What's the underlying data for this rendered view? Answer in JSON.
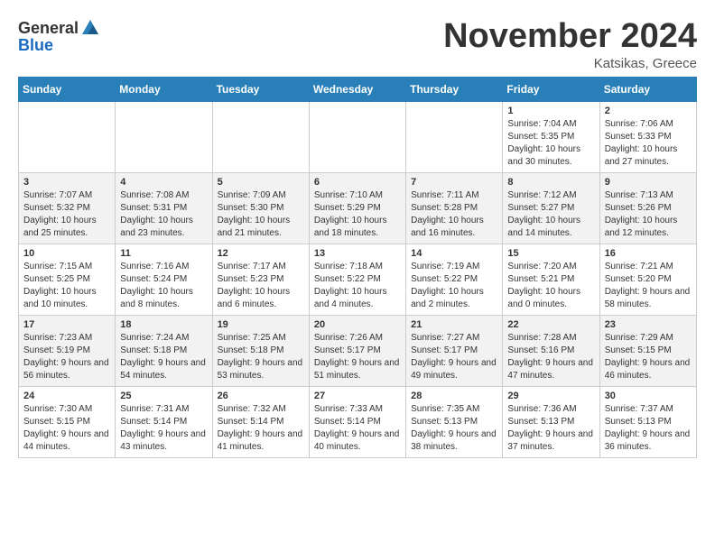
{
  "header": {
    "logo_general": "General",
    "logo_blue": "Blue",
    "month_title": "November 2024",
    "location": "Katsikas, Greece"
  },
  "days_of_week": [
    "Sunday",
    "Monday",
    "Tuesday",
    "Wednesday",
    "Thursday",
    "Friday",
    "Saturday"
  ],
  "weeks": [
    [
      {
        "day": "",
        "info": ""
      },
      {
        "day": "",
        "info": ""
      },
      {
        "day": "",
        "info": ""
      },
      {
        "day": "",
        "info": ""
      },
      {
        "day": "",
        "info": ""
      },
      {
        "day": "1",
        "info": "Sunrise: 7:04 AM\nSunset: 5:35 PM\nDaylight: 10 hours and 30 minutes."
      },
      {
        "day": "2",
        "info": "Sunrise: 7:06 AM\nSunset: 5:33 PM\nDaylight: 10 hours and 27 minutes."
      }
    ],
    [
      {
        "day": "3",
        "info": "Sunrise: 7:07 AM\nSunset: 5:32 PM\nDaylight: 10 hours and 25 minutes."
      },
      {
        "day": "4",
        "info": "Sunrise: 7:08 AM\nSunset: 5:31 PM\nDaylight: 10 hours and 23 minutes."
      },
      {
        "day": "5",
        "info": "Sunrise: 7:09 AM\nSunset: 5:30 PM\nDaylight: 10 hours and 21 minutes."
      },
      {
        "day": "6",
        "info": "Sunrise: 7:10 AM\nSunset: 5:29 PM\nDaylight: 10 hours and 18 minutes."
      },
      {
        "day": "7",
        "info": "Sunrise: 7:11 AM\nSunset: 5:28 PM\nDaylight: 10 hours and 16 minutes."
      },
      {
        "day": "8",
        "info": "Sunrise: 7:12 AM\nSunset: 5:27 PM\nDaylight: 10 hours and 14 minutes."
      },
      {
        "day": "9",
        "info": "Sunrise: 7:13 AM\nSunset: 5:26 PM\nDaylight: 10 hours and 12 minutes."
      }
    ],
    [
      {
        "day": "10",
        "info": "Sunrise: 7:15 AM\nSunset: 5:25 PM\nDaylight: 10 hours and 10 minutes."
      },
      {
        "day": "11",
        "info": "Sunrise: 7:16 AM\nSunset: 5:24 PM\nDaylight: 10 hours and 8 minutes."
      },
      {
        "day": "12",
        "info": "Sunrise: 7:17 AM\nSunset: 5:23 PM\nDaylight: 10 hours and 6 minutes."
      },
      {
        "day": "13",
        "info": "Sunrise: 7:18 AM\nSunset: 5:22 PM\nDaylight: 10 hours and 4 minutes."
      },
      {
        "day": "14",
        "info": "Sunrise: 7:19 AM\nSunset: 5:22 PM\nDaylight: 10 hours and 2 minutes."
      },
      {
        "day": "15",
        "info": "Sunrise: 7:20 AM\nSunset: 5:21 PM\nDaylight: 10 hours and 0 minutes."
      },
      {
        "day": "16",
        "info": "Sunrise: 7:21 AM\nSunset: 5:20 PM\nDaylight: 9 hours and 58 minutes."
      }
    ],
    [
      {
        "day": "17",
        "info": "Sunrise: 7:23 AM\nSunset: 5:19 PM\nDaylight: 9 hours and 56 minutes."
      },
      {
        "day": "18",
        "info": "Sunrise: 7:24 AM\nSunset: 5:18 PM\nDaylight: 9 hours and 54 minutes."
      },
      {
        "day": "19",
        "info": "Sunrise: 7:25 AM\nSunset: 5:18 PM\nDaylight: 9 hours and 53 minutes."
      },
      {
        "day": "20",
        "info": "Sunrise: 7:26 AM\nSunset: 5:17 PM\nDaylight: 9 hours and 51 minutes."
      },
      {
        "day": "21",
        "info": "Sunrise: 7:27 AM\nSunset: 5:17 PM\nDaylight: 9 hours and 49 minutes."
      },
      {
        "day": "22",
        "info": "Sunrise: 7:28 AM\nSunset: 5:16 PM\nDaylight: 9 hours and 47 minutes."
      },
      {
        "day": "23",
        "info": "Sunrise: 7:29 AM\nSunset: 5:15 PM\nDaylight: 9 hours and 46 minutes."
      }
    ],
    [
      {
        "day": "24",
        "info": "Sunrise: 7:30 AM\nSunset: 5:15 PM\nDaylight: 9 hours and 44 minutes."
      },
      {
        "day": "25",
        "info": "Sunrise: 7:31 AM\nSunset: 5:14 PM\nDaylight: 9 hours and 43 minutes."
      },
      {
        "day": "26",
        "info": "Sunrise: 7:32 AM\nSunset: 5:14 PM\nDaylight: 9 hours and 41 minutes."
      },
      {
        "day": "27",
        "info": "Sunrise: 7:33 AM\nSunset: 5:14 PM\nDaylight: 9 hours and 40 minutes."
      },
      {
        "day": "28",
        "info": "Sunrise: 7:35 AM\nSunset: 5:13 PM\nDaylight: 9 hours and 38 minutes."
      },
      {
        "day": "29",
        "info": "Sunrise: 7:36 AM\nSunset: 5:13 PM\nDaylight: 9 hours and 37 minutes."
      },
      {
        "day": "30",
        "info": "Sunrise: 7:37 AM\nSunset: 5:13 PM\nDaylight: 9 hours and 36 minutes."
      }
    ]
  ]
}
